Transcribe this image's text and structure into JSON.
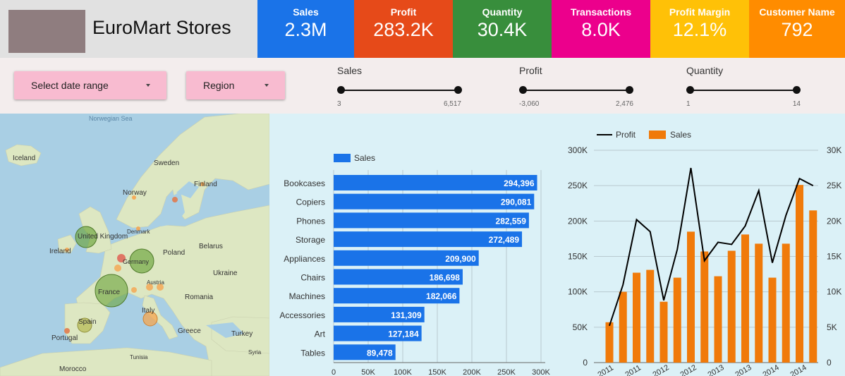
{
  "brand": {
    "title": "EuroMart Stores"
  },
  "kpis": [
    {
      "label": "Sales",
      "value": "2.3M",
      "color": "#1a73e8"
    },
    {
      "label": "Profit",
      "value": "283.2K",
      "color": "#e64a19"
    },
    {
      "label": "Quantity",
      "value": "30.4K",
      "color": "#388e3c"
    },
    {
      "label": "Transactions",
      "value": "8.0K",
      "color": "#ec008c"
    },
    {
      "label": "Profit Margin",
      "value": "12.1%",
      "color": "#ffc107"
    },
    {
      "label": "Customer Name",
      "value": "792",
      "color": "#ff8c00"
    }
  ],
  "filters": {
    "date_range": "Select date range",
    "region": "Region",
    "sliders": [
      {
        "name": "Sales",
        "min": "3",
        "max": "6,517"
      },
      {
        "name": "Profit",
        "min": "-3,060",
        "max": "2,476"
      },
      {
        "name": "Quantity",
        "min": "1",
        "max": "14"
      }
    ]
  },
  "map": {
    "labels": [
      "Norwegian Sea",
      "Iceland",
      "Sweden",
      "Finland",
      "Norway",
      "Denmark",
      "United Kingdom",
      "Ireland",
      "Belarus",
      "Poland",
      "Germany",
      "Ukraine",
      "Austria",
      "France",
      "Romania",
      "Italy",
      "Spain",
      "Portugal",
      "Greece",
      "Turkey",
      "Syria",
      "Tunisia",
      "Morocco"
    ],
    "colors": {
      "sea": "#a9cfe4",
      "land": "#dde7c2",
      "big_bubble": "#6aa339",
      "small_bubble": "#f6a54f",
      "hot_bubble": "#e05a4e"
    }
  },
  "chart_data": [
    {
      "type": "bar",
      "orientation": "horizontal",
      "categories": [
        "Bookcases",
        "Copiers",
        "Phones",
        "Storage",
        "Appliances",
        "Chairs",
        "Machines",
        "Accessories",
        "Art",
        "Tables"
      ],
      "series": [
        {
          "name": "Sales",
          "values": [
            294396,
            290081,
            282559,
            272489,
            209900,
            186698,
            182066,
            131309,
            127184,
            89478
          ],
          "color": "#1a73e8"
        }
      ],
      "value_labels": [
        "294,396",
        "290,081",
        "282,559",
        "272,489",
        "209,900",
        "186,698",
        "182,066",
        "131,309",
        "127,184",
        "89,478"
      ],
      "xlim": [
        0,
        300000
      ],
      "xticks": [
        "0",
        "50K",
        "100K",
        "150K",
        "200K",
        "250K",
        "300K"
      ],
      "legend": "top-left",
      "grid": true
    },
    {
      "type": "bar",
      "combo": "bar+line",
      "series": [
        {
          "name": "Profit",
          "type": "line",
          "axis": "right",
          "color": "#000000",
          "values": [
            5200,
            11000,
            20200,
            18500,
            8800,
            16000,
            27500,
            14400,
            17000,
            16700,
            19300,
            24300,
            14100,
            20800,
            26000,
            25000
          ]
        },
        {
          "name": "Sales",
          "type": "bar",
          "axis": "left",
          "color": "#f07a0a",
          "values": [
            57000,
            100000,
            127000,
            131000,
            86000,
            120000,
            185000,
            157000,
            122000,
            158000,
            181000,
            168000,
            120000,
            168000,
            251000,
            215000
          ]
        }
      ],
      "ylim": [
        0,
        300000
      ],
      "y2lim": [
        0,
        30000
      ],
      "yticks": [
        "0",
        "50K",
        "100K",
        "150K",
        "200K",
        "250K",
        "300K"
      ],
      "y2ticks": [
        "0",
        "5K",
        "10K",
        "15K",
        "20K",
        "25K",
        "30K"
      ],
      "xtick_labels": [
        "2011",
        "2011",
        "2012",
        "2012",
        "2013",
        "2013",
        "2014",
        "2014"
      ],
      "legend": "top-left",
      "grid": true
    }
  ]
}
